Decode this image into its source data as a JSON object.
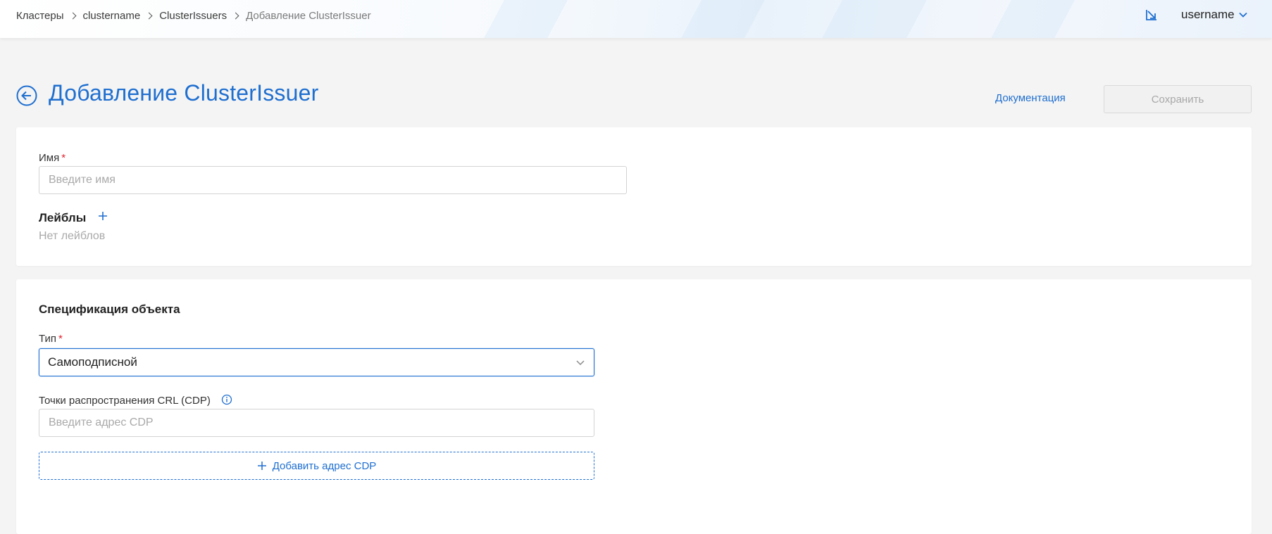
{
  "breadcrumb": [
    {
      "label": "Кластеры"
    },
    {
      "label": "clustername"
    },
    {
      "label": "ClusterIssuers"
    },
    {
      "label": "Добавление ClusterIssuer"
    }
  ],
  "header": {
    "username": "username",
    "export_icon": "external-link-icon"
  },
  "page": {
    "title": "Добавление ClusterIssuer",
    "doc_link": "Документация",
    "save_label": "Сохранить"
  },
  "general": {
    "name_label": "Имя",
    "name_required": "*",
    "name_placeholder": "Введите имя",
    "name_value": "",
    "labels_title": "Лейблы",
    "labels_empty": "Нет лейблов"
  },
  "spec": {
    "title": "Спецификация объекта",
    "type_label": "Тип",
    "type_required": "*",
    "type_value": "Самоподписной",
    "cdp_label": "Точки распространения CRL (CDP)",
    "cdp_placeholder": "Введите адрес CDP",
    "cdp_value": "",
    "add_cdp_label": "Добавить адрес CDP"
  },
  "colors": {
    "accent": "#1f6fd0",
    "required": "#e0242f",
    "placeholder": "#a9a9a9",
    "background": "#f4f4f4"
  }
}
